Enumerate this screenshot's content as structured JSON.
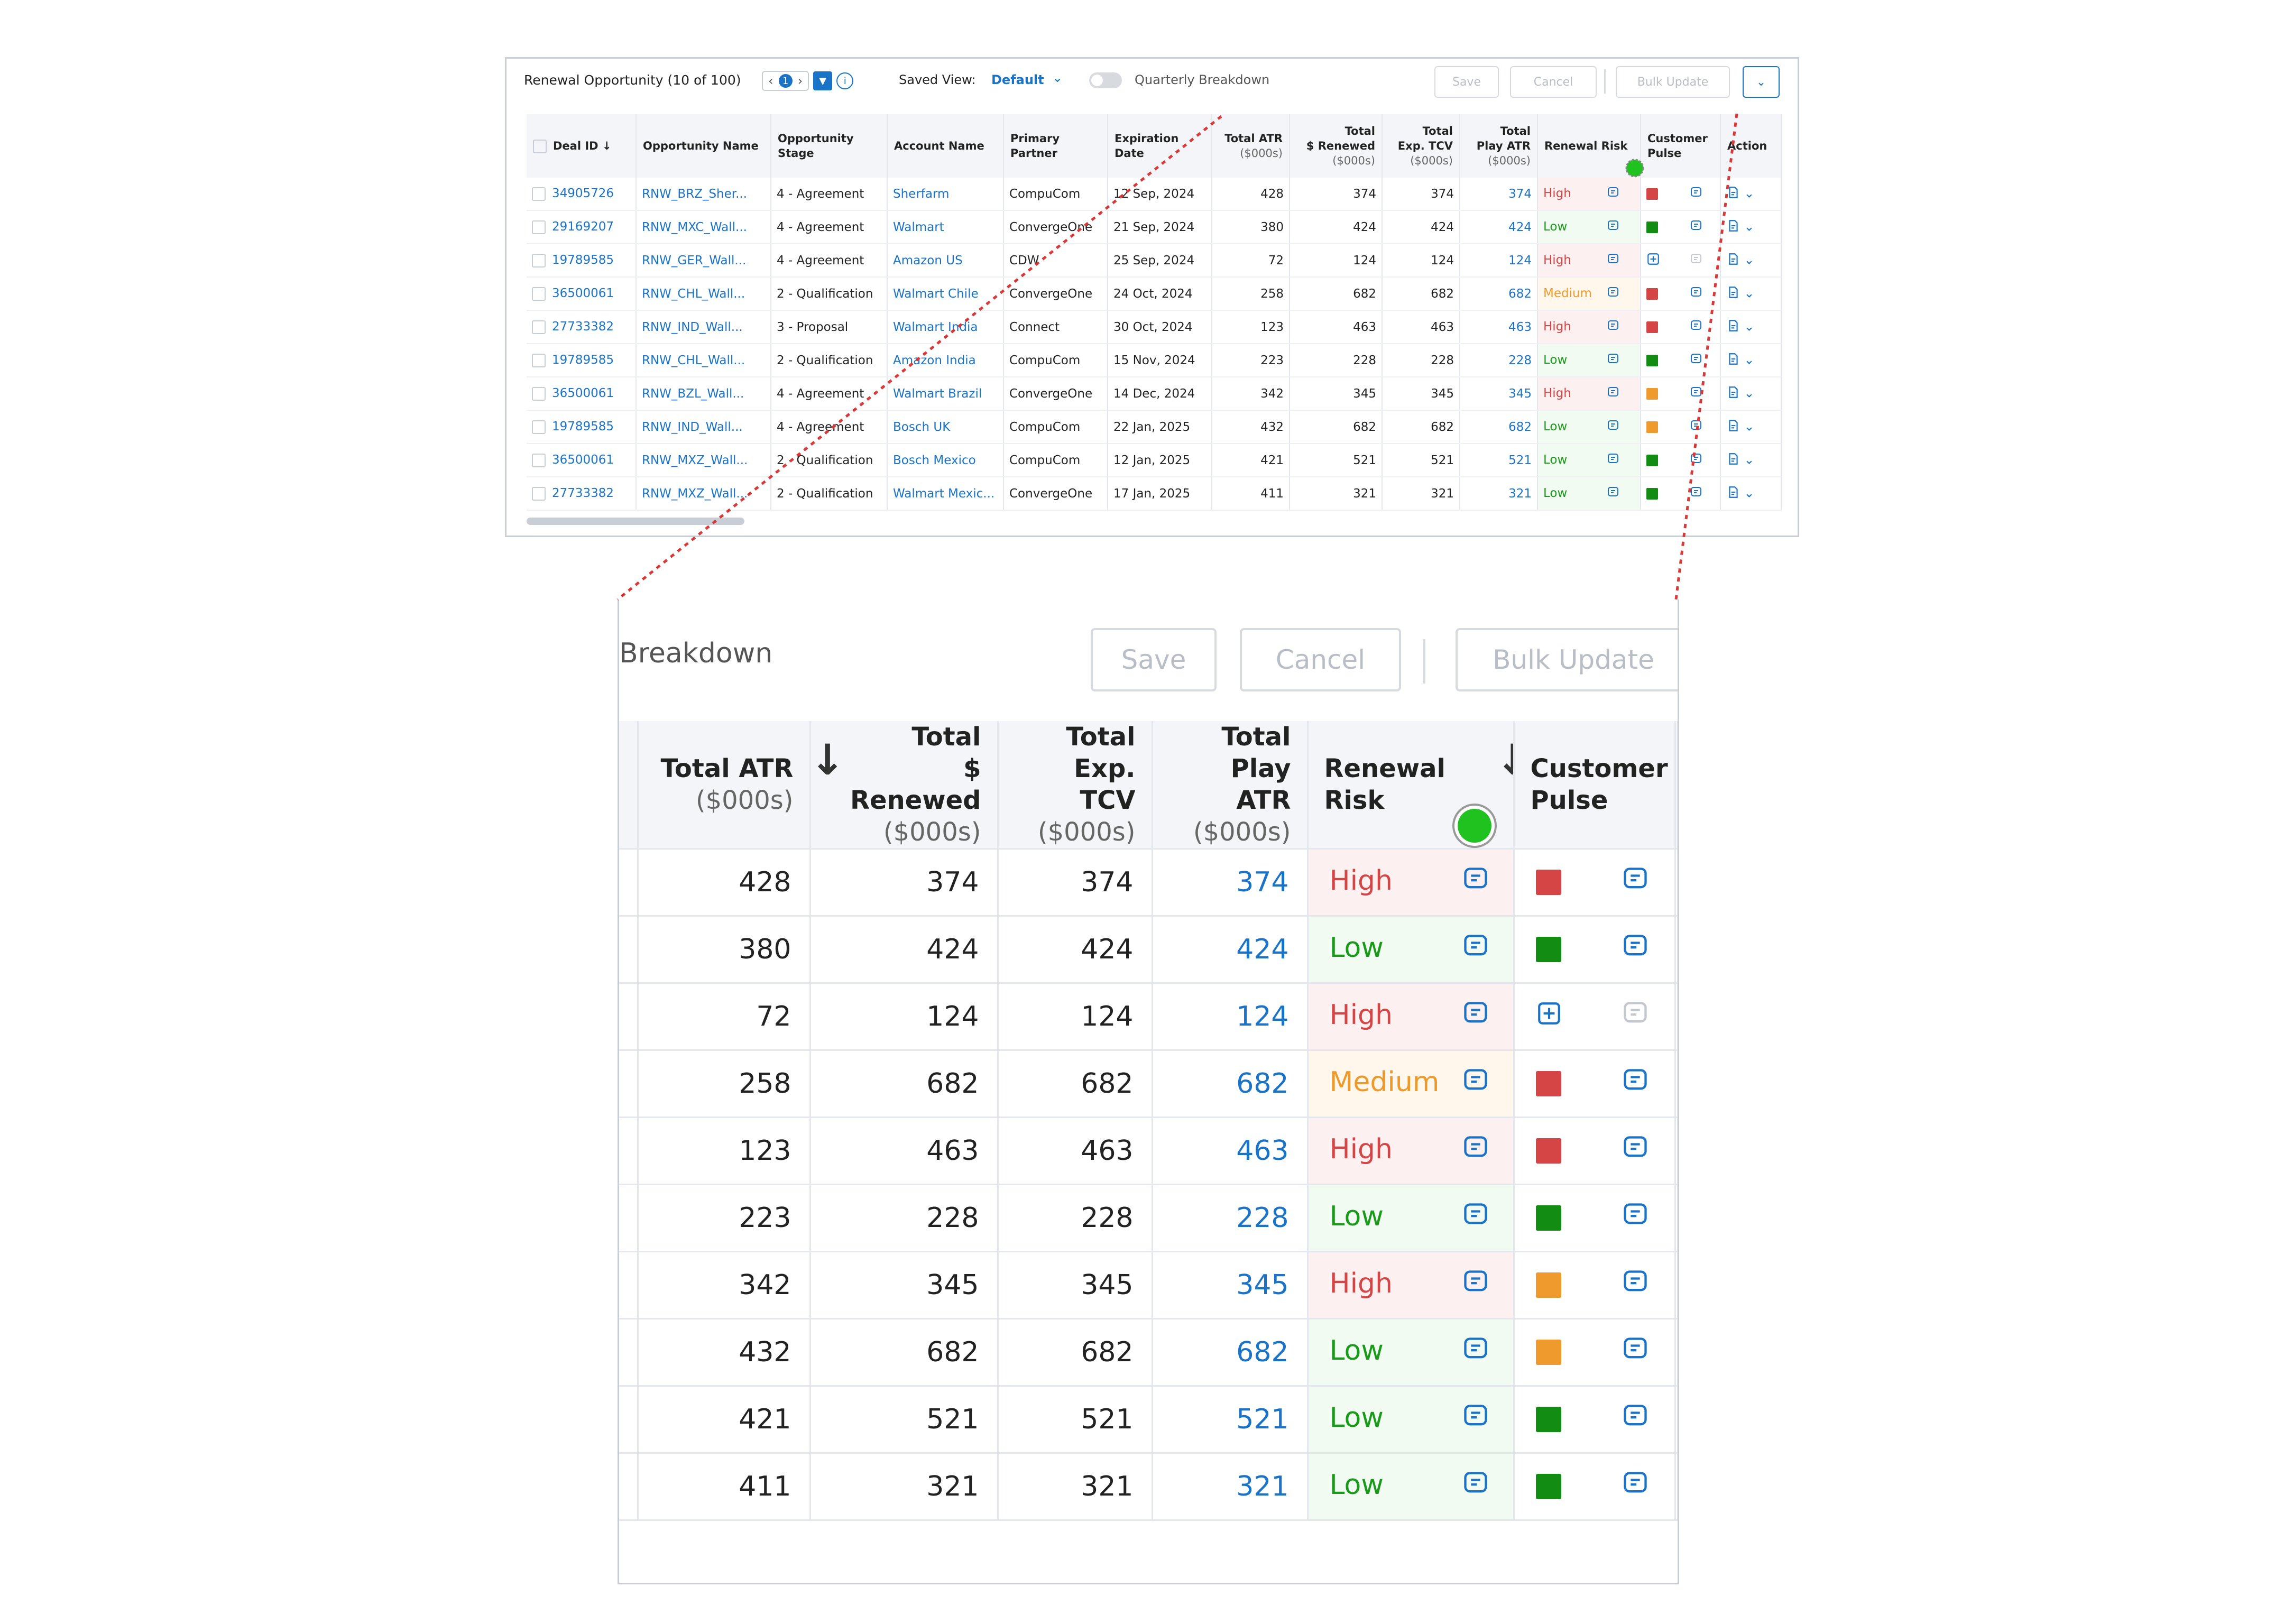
{
  "toolbar": {
    "title": "Renewal Opportunity (10 of 100)",
    "page_number": "1",
    "saved_view_label": "Saved View:",
    "saved_view_value": "Default",
    "quarterly_breakdown_label": "Quarterly Breakdown",
    "save_label": "Save",
    "cancel_label": "Cancel",
    "bulk_update_label": "Bulk Update"
  },
  "columns": {
    "deal_id": "Deal ID",
    "opportunity_name": "Opportunity Name",
    "opportunity_stage": "Opportunity Stage",
    "account_name": "Account Name",
    "primary_partner": "Primary Partner",
    "expiration_date": "Expiration Date",
    "total_atr": "Total ATR",
    "total_renewed_a": "Total",
    "total_renewed_b": "$ Renewed",
    "total_exp_a": "Total",
    "total_exp_b": "Exp. TCV",
    "total_play_a": "Total",
    "total_play_b": "Play ATR",
    "unit": "($000s)",
    "renewal_risk": "Renewal Risk",
    "customer_pulse": "Customer Pulse",
    "action": "Action"
  },
  "rows": [
    {
      "deal_id": "34905726",
      "opp": "RNW_BRZ_Sher...",
      "stage": "4 - Agreement",
      "account": "Sherfarm",
      "partner": "CompuCom",
      "date": "12 Sep, 2024",
      "atr": "428",
      "renewed": "374",
      "tcv": "374",
      "play": "374",
      "risk": "High",
      "pulse": "red"
    },
    {
      "deal_id": "29169207",
      "opp": "RNW_MXC_Wall...",
      "stage": "4 - Agreement",
      "account": "Walmart",
      "partner": "ConvergeOne",
      "date": "21 Sep, 2024",
      "atr": "380",
      "renewed": "424",
      "tcv": "424",
      "play": "424",
      "risk": "Low",
      "pulse": "green"
    },
    {
      "deal_id": "19789585",
      "opp": "RNW_GER_Wall...",
      "stage": "4 - Agreement",
      "account": "Amazon US",
      "partner": "CDW",
      "date": "25 Sep, 2024",
      "atr": "72",
      "renewed": "124",
      "tcv": "124",
      "play": "124",
      "risk": "High",
      "pulse": "add"
    },
    {
      "deal_id": "36500061",
      "opp": "RNW_CHL_Wall...",
      "stage": "2 - Qualification",
      "account": "Walmart Chile",
      "partner": "ConvergeOne",
      "date": "24 Oct, 2024",
      "atr": "258",
      "renewed": "682",
      "tcv": "682",
      "play": "682",
      "risk": "Medium",
      "pulse": "red"
    },
    {
      "deal_id": "27733382",
      "opp": "RNW_IND_Wall...",
      "stage": "3 - Proposal",
      "account": "Walmart India",
      "partner": "Connect",
      "date": "30 Oct, 2024",
      "atr": "123",
      "renewed": "463",
      "tcv": "463",
      "play": "463",
      "risk": "High",
      "pulse": "red"
    },
    {
      "deal_id": "19789585",
      "opp": "RNW_CHL_Wall...",
      "stage": "2 - Qualification",
      "account": "Amazon India",
      "partner": "CompuCom",
      "date": "15 Nov, 2024",
      "atr": "223",
      "renewed": "228",
      "tcv": "228",
      "play": "228",
      "risk": "Low",
      "pulse": "green"
    },
    {
      "deal_id": "36500061",
      "opp": "RNW_BZL_Wall...",
      "stage": "4 - Agreement",
      "account": "Walmart Brazil",
      "partner": "ConvergeOne",
      "date": "14 Dec, 2024",
      "atr": "342",
      "renewed": "345",
      "tcv": "345",
      "play": "345",
      "risk": "High",
      "pulse": "orange"
    },
    {
      "deal_id": "19789585",
      "opp": "RNW_IND_Wall...",
      "stage": "4 - Agreement",
      "account": "Bosch UK",
      "partner": "CompuCom",
      "date": "22 Jan, 2025",
      "atr": "432",
      "renewed": "682",
      "tcv": "682",
      "play": "682",
      "risk": "Low",
      "pulse": "orange"
    },
    {
      "deal_id": "36500061",
      "opp": "RNW_MXZ_Wall...",
      "stage": "2 - Qualification",
      "account": "Bosch Mexico",
      "partner": "CompuCom",
      "date": "12 Jan, 2025",
      "atr": "421",
      "renewed": "521",
      "tcv": "521",
      "play": "521",
      "risk": "Low",
      "pulse": "green"
    },
    {
      "deal_id": "27733382",
      "opp": "RNW_MXZ_Wall...",
      "stage": "2 - Qualification",
      "account": "Walmart Mexic...",
      "partner": "ConvergeOne",
      "date": "17 Jan, 2025",
      "atr": "411",
      "renewed": "321",
      "tcv": "321",
      "play": "321",
      "risk": "Low",
      "pulse": "green"
    }
  ],
  "zoom": {
    "title": "Breakdown"
  },
  "colors": {
    "accent": "#1a73c7",
    "risk_high": "#d54545",
    "risk_low": "#1a9a1a",
    "risk_medium": "#ee9a2a",
    "pulse_red": "#d54545",
    "pulse_green": "#128c12",
    "pulse_orange": "#ef9a2c",
    "highlight_dot": "#1fc21f"
  }
}
